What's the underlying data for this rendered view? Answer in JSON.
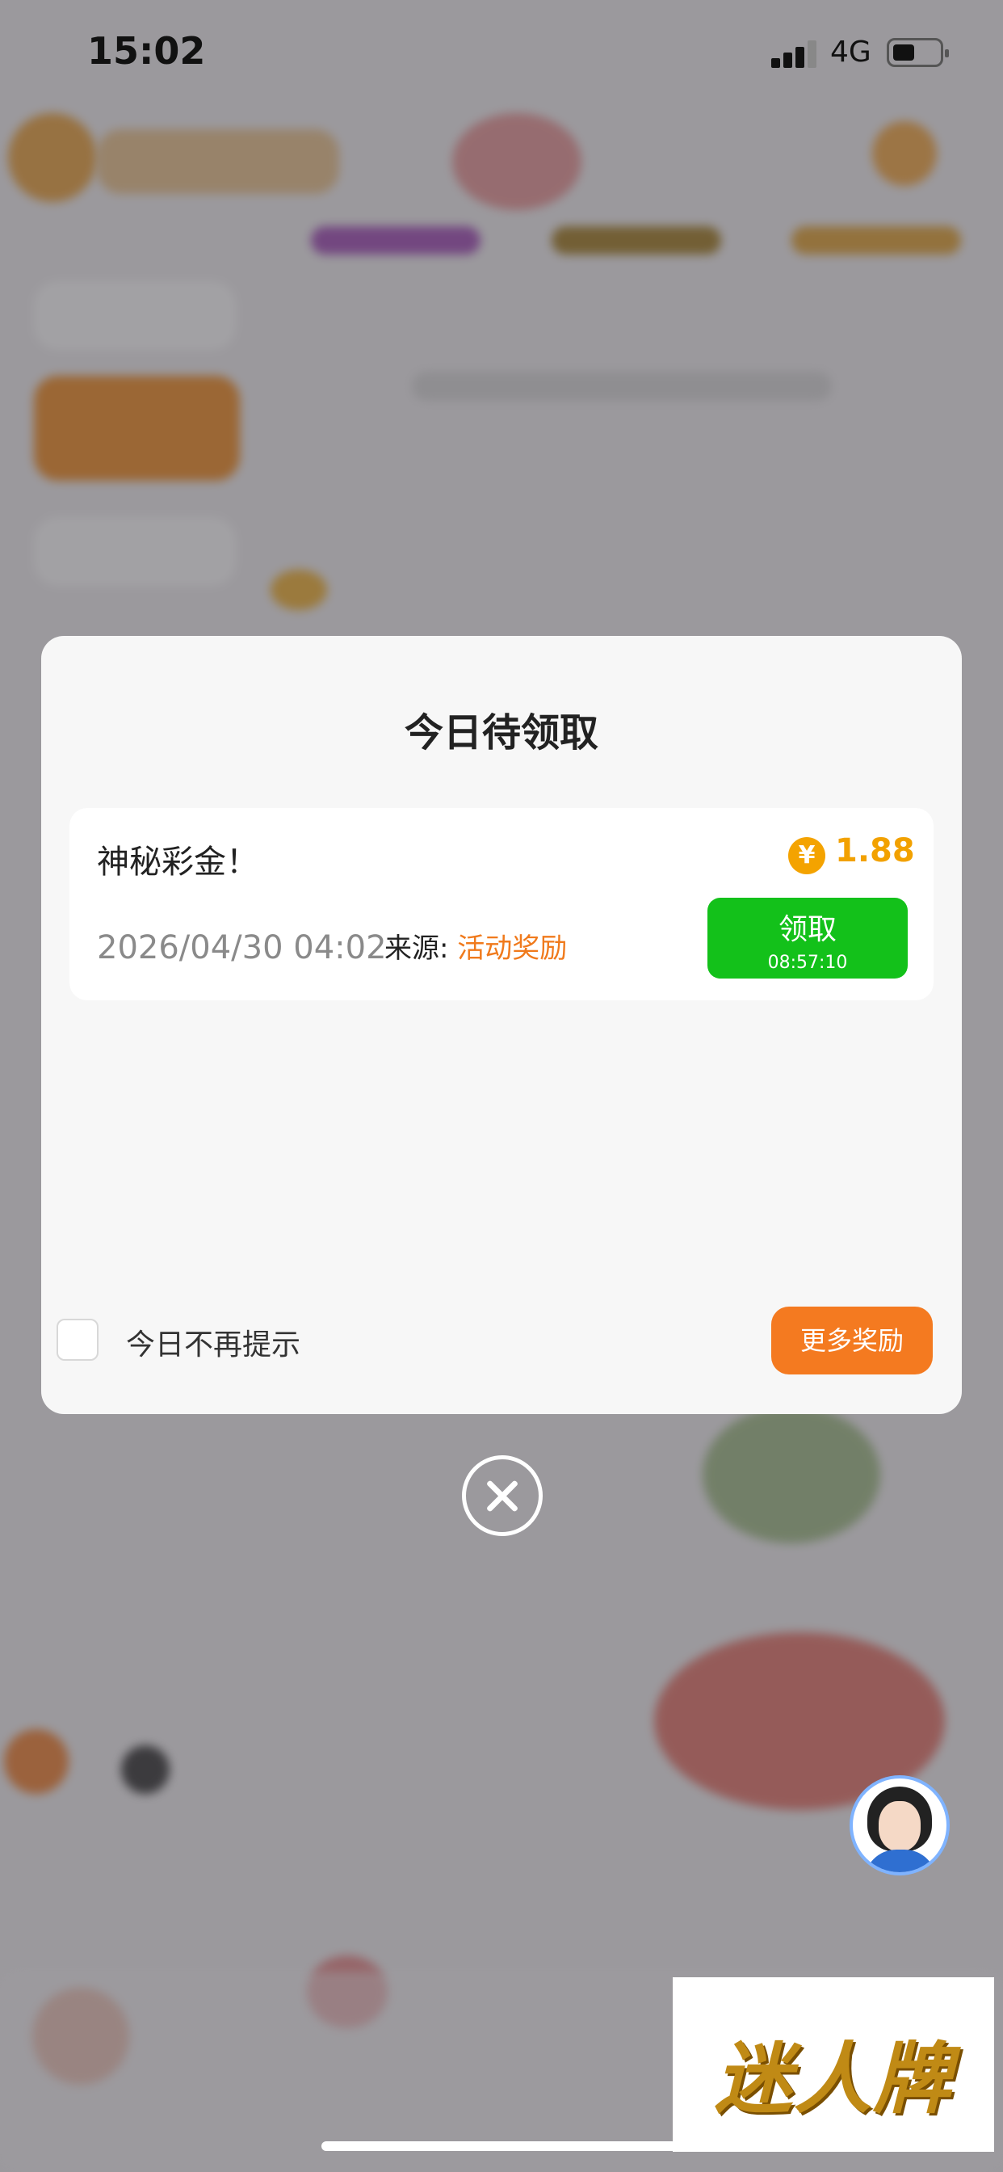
{
  "status_bar": {
    "time": "15:02",
    "network": "4G"
  },
  "modal": {
    "title": "今日待领取",
    "reward": {
      "title": "神秘彩金！",
      "coin_symbol": "¥",
      "amount": "1.88",
      "date": "2026/04/30 04:02",
      "source_label": "来源:",
      "source_value": "活动奖励",
      "claim_label": "领取",
      "countdown": "08:57:10"
    },
    "dont_show_label": "今日不再提示",
    "more_button": "更多奖励"
  },
  "brand": {
    "text": "迷人牌"
  },
  "colors": {
    "accent_orange": "#f47a20",
    "claim_green": "#13c11a",
    "amount_gold": "#f2a100"
  }
}
